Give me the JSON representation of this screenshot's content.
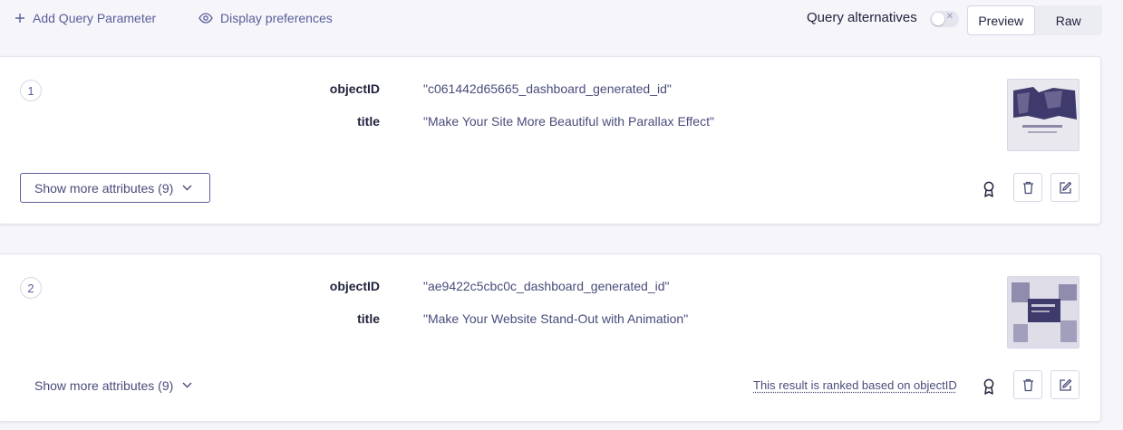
{
  "toolbar": {
    "add_query_parameter": "Add Query Parameter",
    "display_preferences": "Display preferences",
    "query_alternatives": "Query alternatives",
    "query_alternatives_enabled": false,
    "view_tabs": [
      "Preview",
      "Raw"
    ],
    "active_view": "Preview"
  },
  "results": [
    {
      "rank": "1",
      "attributes": [
        {
          "key": "objectID",
          "value": "\"c061442d65665_dashboard_generated_id\""
        },
        {
          "key": "title",
          "value": "\"Make Your Site More Beautiful with Parallax Effect\""
        }
      ],
      "show_more_label": "Show more attributes (9)",
      "ranked_note": ""
    },
    {
      "rank": "2",
      "attributes": [
        {
          "key": "objectID",
          "value": "\"ae9422c5cbc0c_dashboard_generated_id\""
        },
        {
          "key": "title",
          "value": "\"Make Your Website Stand-Out with Animation\""
        }
      ],
      "show_more_label": "Show more attributes (9)",
      "ranked_note": "This result is ranked based on objectID"
    }
  ],
  "icons": {
    "add": "plus-icon",
    "display": "eye-icon",
    "toggle_off": "x-icon",
    "chevron": "chevron-down-icon",
    "promote": "award-icon",
    "delete": "trash-icon",
    "edit": "edit-icon"
  },
  "colors": {
    "background": "#f5f5fa",
    "text_primary": "#21243d",
    "text_secondary": "#5a5e9a",
    "border": "#d6d6e7",
    "thumb_purple": "#3e3a6b"
  }
}
